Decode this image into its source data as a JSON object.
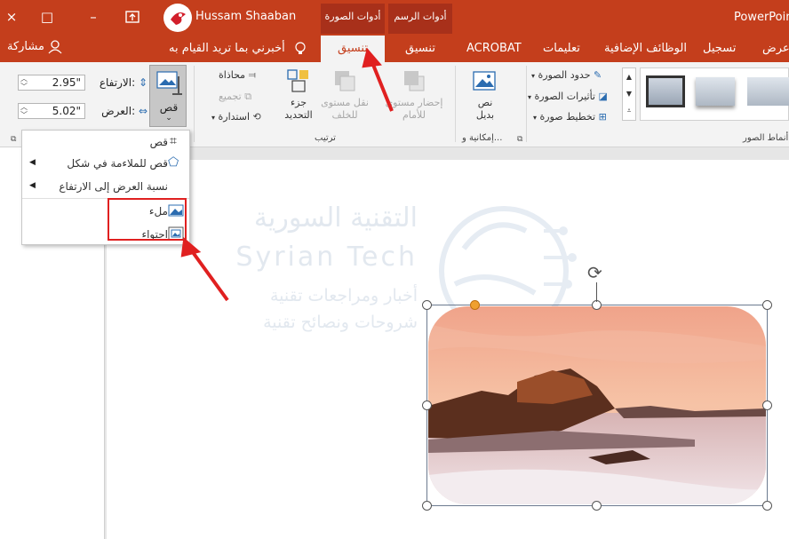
{
  "titlebar": {
    "user_name": "Hussam Shaaban",
    "app_name": "PowerPoin",
    "ctx_picture_tools": "أدوات الصورة",
    "ctx_drawing_tools": "أدوات الرسم",
    "close": "×",
    "minimize": "–",
    "maximize": "□"
  },
  "tabs": {
    "share": "مشاركة",
    "tell_me": "أخبرني بما تريد القيام به",
    "format_active": "تنسيق",
    "format2": "تنسيق",
    "acrobat": "ACROBAT",
    "help": "تعليمات",
    "addins": "الوظائف الإضافية",
    "record": "تسجيل",
    "view": "عرض"
  },
  "ribbon": {
    "height_label": "الارتفاع:",
    "height_value": "2.95\"",
    "width_label": "العرض:",
    "width_value": "5.02\"",
    "crop_label": "قص",
    "align": "محاذاة",
    "group": "تجميع",
    "rotate": "استدارة",
    "selection_pane_1": "جزء",
    "selection_pane_2": "التحديد",
    "send_backward_1": "نقل مستوى",
    "send_backward_2": "للخلف",
    "bring_forward_1": "إحضار مستوى",
    "bring_forward_2": "للأمام",
    "arrange_label": "ترتيب",
    "alt_text_1": "نص",
    "alt_text_2": "بديل",
    "accessibility_label": "إمكانية و...",
    "picture_border": "حدود الصورة",
    "picture_effects": "تأثيرات الصورة",
    "picture_layout": "تخطيط صورة",
    "picture_styles_label": "أنماط الصور"
  },
  "crop_menu": {
    "crop": "قص",
    "crop_to_shape": "قص للملاءمة في شكل",
    "aspect_ratio": "نسبة العرض إلى الارتفاع",
    "fill": "ملء",
    "fit": "احتواء"
  },
  "watermark": {
    "arabic_title": "التقنية السورية",
    "english_title": "Syrian Tech",
    "line1": "أخبار ومراجعات تقنية",
    "line2": "شروحات ونصائح تقنية"
  },
  "colors": {
    "accent": "#c43e1c",
    "annotation_red": "#e02020"
  }
}
